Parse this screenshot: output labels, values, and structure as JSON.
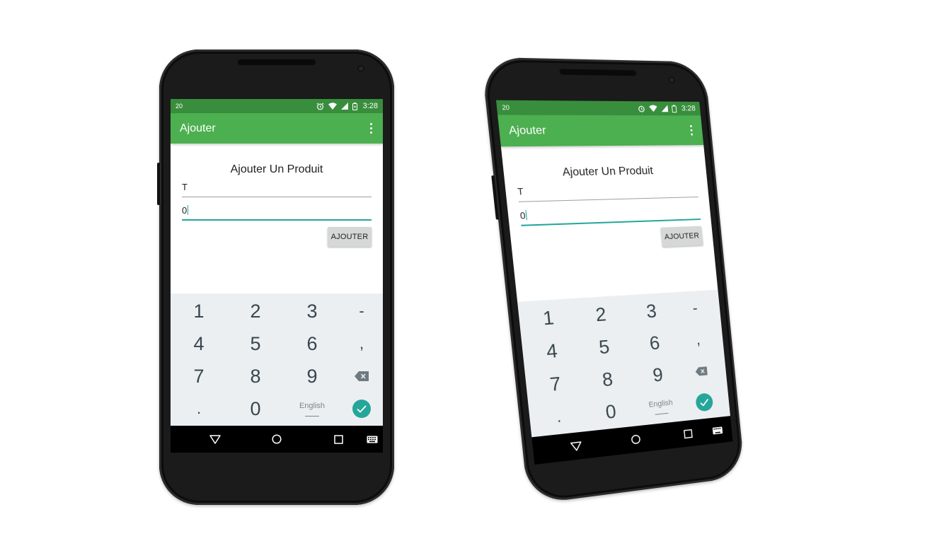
{
  "status_bar": {
    "notification": "20",
    "time": "3:28"
  },
  "app_bar": {
    "title": "Ajouter",
    "menu_icon": "overflow-menu-icon"
  },
  "form": {
    "heading": "Ajouter Un Produit",
    "name_value": "T",
    "quantity_value": "0",
    "submit_label": "AJOUTER"
  },
  "keyboard": {
    "row1": [
      "1",
      "2",
      "3",
      "-"
    ],
    "row2": [
      "4",
      "5",
      "6",
      ","
    ],
    "row3": [
      "7",
      "8",
      "9"
    ],
    "row4": [
      ".",
      "0"
    ],
    "language": "English",
    "backspace_icon": "backspace-icon",
    "done_icon": "check-icon"
  },
  "colors": {
    "primary": "#4CAF50",
    "primary_dark": "#388E3C",
    "accent": "#26A69A",
    "keyboard_bg": "#ECEFF1",
    "key_text": "#37474F"
  }
}
